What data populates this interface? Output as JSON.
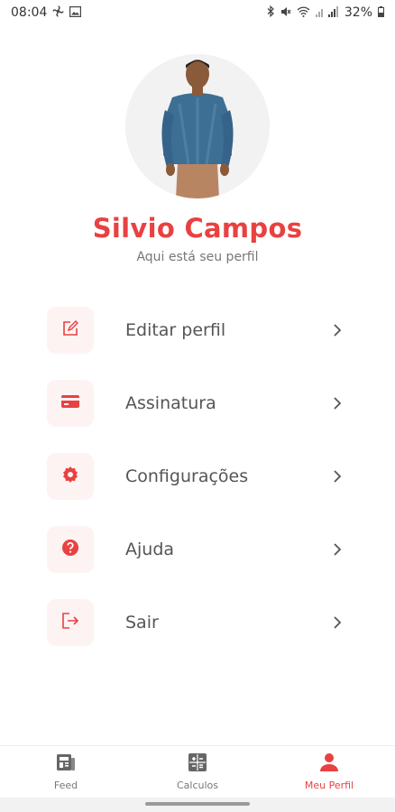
{
  "status_bar": {
    "time": "08:04",
    "battery": "32%"
  },
  "profile": {
    "name": "Silvio Campos",
    "subtitle": "Aqui está seu perfil"
  },
  "menu": {
    "items": [
      {
        "label": "Editar perfil",
        "icon": "edit-icon"
      },
      {
        "label": "Assinatura",
        "icon": "credit-card-icon"
      },
      {
        "label": "Configurações",
        "icon": "gear-icon"
      },
      {
        "label": "Ajuda",
        "icon": "help-icon"
      },
      {
        "label": "Sair",
        "icon": "logout-icon"
      }
    ]
  },
  "bottom_nav": {
    "items": [
      {
        "label": "Feed",
        "icon": "newspaper-icon",
        "active": false
      },
      {
        "label": "Calculos",
        "icon": "calculator-icon",
        "active": false
      },
      {
        "label": "Meu Perfil",
        "icon": "person-icon",
        "active": true
      }
    ]
  },
  "colors": {
    "accent": "#e94141",
    "icon_bg": "#fdf3f3",
    "text": "#555555"
  }
}
